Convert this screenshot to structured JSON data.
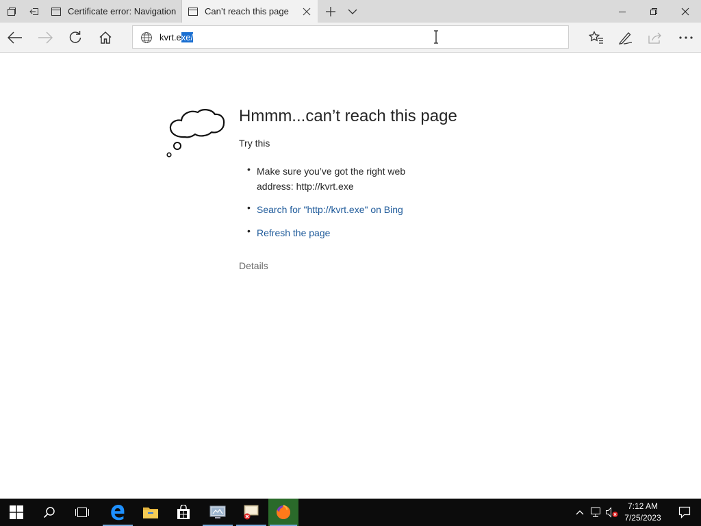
{
  "tabs": [
    {
      "title": "Certificate error: Navigation",
      "active": false
    },
    {
      "title": "Can’t reach this page",
      "active": true
    }
  ],
  "address": {
    "text_plain": "kvrt.e",
    "text_selected": "xe/"
  },
  "page": {
    "title": "Hmmm...can’t reach this page",
    "try_this": "Try this",
    "suggestion_1_line1": "Make sure you’ve got the right web",
    "suggestion_1_line2": "address: http://kvrt.exe",
    "suggestion_2": "Search for \"http://kvrt.exe\" on Bing",
    "suggestion_3": "Refresh the page",
    "details": "Details"
  },
  "clock": {
    "time": "7:12 AM",
    "date": "7/25/2023"
  },
  "icons": {
    "tab_icon": "page-icon",
    "back": "back-arrow-icon",
    "forward": "forward-arrow-icon",
    "refresh": "refresh-icon",
    "home": "home-icon",
    "favorites": "favorites-star-icon",
    "notes": "pen-icon",
    "share": "share-icon",
    "more": "ellipsis-icon"
  },
  "colors": {
    "link": "#1e5a9a",
    "selection": "#1a6fd1",
    "tabstrip": "#dadada",
    "toolbar": "#f2f2f2",
    "taskbar": "#0c0c0c"
  }
}
